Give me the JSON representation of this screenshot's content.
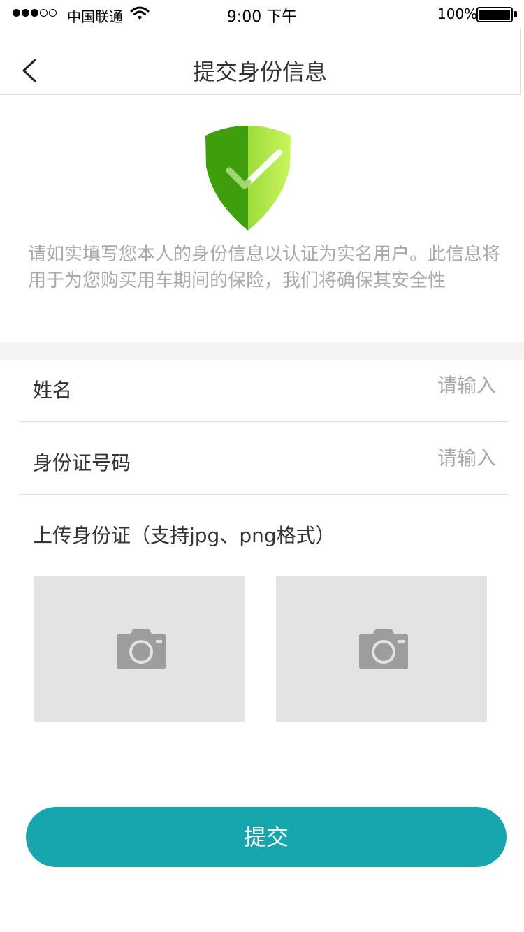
{
  "status_bar": {
    "carrier": "中国联通",
    "time": "9:00 下午",
    "battery": "100%",
    "battery_level": 1.0,
    "signal_bars": 3,
    "signal_max": 5,
    "wifi_icon": "wifi-icon"
  },
  "nav": {
    "title": "提交身份信息",
    "back_icon": "chevron-left-icon"
  },
  "intro": {
    "icon": "shield-check-icon",
    "description": "请如实填写您本人的身份信息以认证为实名用户。此信息将用于为您购买用车期间的保险，我们将确保其安全性"
  },
  "form": {
    "name": {
      "label": "姓名",
      "placeholder": "请输入",
      "value": ""
    },
    "id_number": {
      "label": "身份证号码",
      "placeholder": "请输入",
      "value": ""
    },
    "upload": {
      "label": "上传身份证（支持jpg、png格式）",
      "slot_icon": "camera-icon",
      "slots": 2
    }
  },
  "submit_label": "提交",
  "colors": {
    "accent": "#17a6ae",
    "shield_dark": "#3d9e0a",
    "shield_light": "#b8ee4c",
    "placeholder_bg": "#e3e3e3",
    "camera": "#9d9d9d"
  }
}
